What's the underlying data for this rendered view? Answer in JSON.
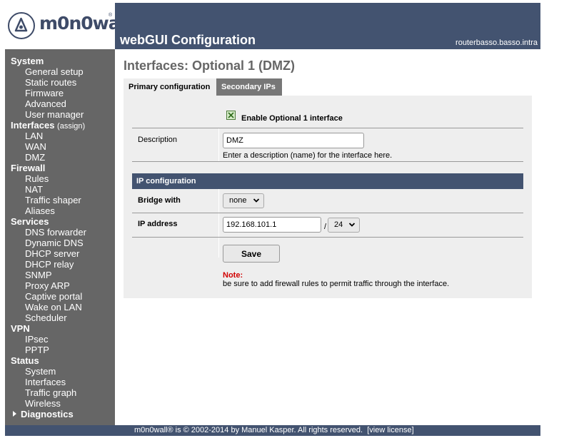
{
  "header": {
    "logo_text": "m0n0wall",
    "logo_reg": "®",
    "title": "webGUI Configuration",
    "hostname": "routerbasso.basso.intra"
  },
  "sidebar": {
    "sections": [
      {
        "label": "System",
        "items": [
          "General setup",
          "Static routes",
          "Firmware",
          "Advanced",
          "User manager"
        ]
      },
      {
        "label": "Interfaces",
        "suffix": "(assign)",
        "items": [
          "LAN",
          "WAN",
          "DMZ"
        ]
      },
      {
        "label": "Firewall",
        "items": [
          "Rules",
          "NAT",
          "Traffic shaper",
          "Aliases"
        ]
      },
      {
        "label": "Services",
        "items": [
          "DNS forwarder",
          "Dynamic DNS",
          "DHCP server",
          "DHCP relay",
          "SNMP",
          "Proxy ARP",
          "Captive portal",
          "Wake on LAN",
          "Scheduler"
        ]
      },
      {
        "label": "VPN",
        "items": [
          "IPsec",
          "PPTP"
        ]
      },
      {
        "label": "Status",
        "items": [
          "System",
          "Interfaces",
          "Traffic graph",
          "Wireless"
        ]
      }
    ],
    "diagnostics": "Diagnostics"
  },
  "page": {
    "title": "Interfaces: Optional 1 (DMZ)",
    "tabs": [
      {
        "label": "Primary configuration",
        "active": true
      },
      {
        "label": "Secondary IPs",
        "active": false
      }
    ]
  },
  "form": {
    "enable_label": "Enable Optional 1 interface",
    "enable_checked": true,
    "description_label": "Description",
    "description_value": "DMZ",
    "description_hint": "Enter a description (name) for the interface here.",
    "ip_section_header": "IP configuration",
    "bridge_label": "Bridge with",
    "bridge_value": "none",
    "ip_label": "IP address",
    "ip_value": "192.168.101.1",
    "ip_separator": "/",
    "subnet_value": "24",
    "save_label": "Save",
    "note_label": "Note:",
    "note_text": "be sure to add firewall rules to permit traffic through the interface."
  },
  "footer": {
    "text": "m0n0wall® is © 2002-2014 by Manuel Kasper. All rights reserved.",
    "link": "[view license]"
  },
  "colors": {
    "header_bg": "#435370",
    "sidebar_bg": "#666666",
    "panel_bg": "#eeeeee",
    "note_red": "#d10000"
  }
}
